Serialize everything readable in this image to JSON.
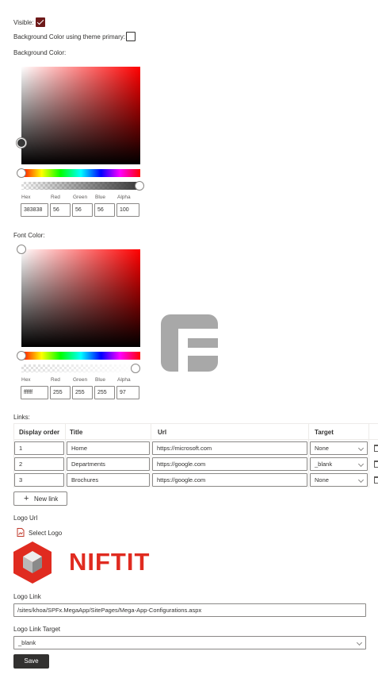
{
  "visible": {
    "label": "Visible:",
    "checked": true
  },
  "bg_theme": {
    "label": "Background Color using theme primary:",
    "checked": false
  },
  "background_color": {
    "section_label": "Background Color:",
    "labels": {
      "hex": "Hex",
      "red": "Red",
      "green": "Green",
      "blue": "Blue",
      "alpha": "Alpha"
    },
    "values": {
      "hex": "383838",
      "red": "56",
      "green": "56",
      "blue": "56",
      "alpha": "100"
    }
  },
  "font_color": {
    "section_label": "Font Color:",
    "labels": {
      "hex": "Hex",
      "red": "Red",
      "green": "Green",
      "blue": "Blue",
      "alpha": "Alpha"
    },
    "values": {
      "hex": "ffffff",
      "red": "255",
      "green": "255",
      "blue": "255",
      "alpha": "97"
    }
  },
  "links": {
    "label": "Links:",
    "columns": [
      "Display order",
      "Title",
      "Url",
      "Target"
    ],
    "rows": [
      {
        "order": "1",
        "title": "Home",
        "url": "https://microsoft.com",
        "target": "None"
      },
      {
        "order": "2",
        "title": "Departments",
        "url": "https://google.com",
        "target": "_blank"
      },
      {
        "order": "3",
        "title": "Brochures",
        "url": "https://google.com",
        "target": "None"
      }
    ],
    "new_link_label": "New link"
  },
  "logo": {
    "section_label": "Logo Url",
    "select_label": "Select Logo",
    "brand_text": "NIFTIT"
  },
  "logo_link": {
    "label": "Logo Link",
    "value": "/sites/khoa/SPFx.MegaApp/SitePages/Mega-App-Configurations.aspx"
  },
  "logo_link_target": {
    "label": "Logo Link Target",
    "value": "_blank"
  },
  "save_label": "Save",
  "colors": {
    "accent": "#6e1a1a",
    "logo_red": "#e02b20"
  }
}
